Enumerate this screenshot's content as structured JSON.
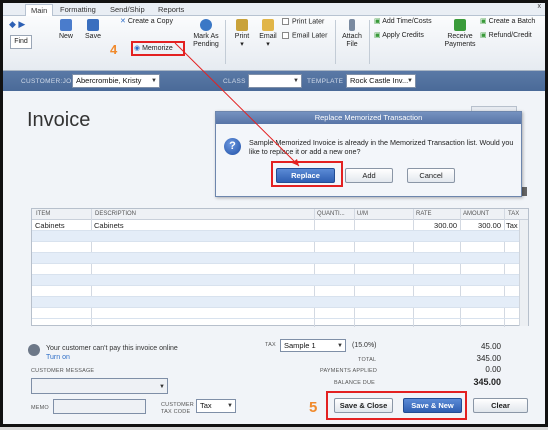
{
  "tabs": [
    "Main",
    "Formatting",
    "Send/Ship",
    "Reports"
  ],
  "ribbon": {
    "find": "Find",
    "new": "New",
    "save": "Save",
    "create_copy": "Create a Copy",
    "memorize": "Memorize",
    "mark_as_pending": [
      "Mark As",
      "Pending"
    ],
    "print": "Print",
    "email": "Email",
    "print_later": "Print Later",
    "email_later": "Email Later",
    "attach_file": [
      "Attach",
      "File"
    ],
    "add_time_costs": "Add Time/Costs",
    "apply_credits": "Apply Credits",
    "receive_payments": [
      "Receive",
      "Payments"
    ],
    "create_batch": "Create a Batch",
    "refund_credit": "Refund/Credit",
    "step_badge": "4"
  },
  "header": {
    "customer_job_label": "CUSTOMER:JOB",
    "customer_job_value": "Abercrombie, Kristy",
    "class_label": "CLASS",
    "class_value": "",
    "template_label": "TEMPLATE",
    "template_value": "Rock Castle Inv..."
  },
  "invoice_title": "Invoice",
  "dialog": {
    "title": "Replace Memorized Transaction",
    "message": "Sample Memorized Invoice is already in the Memorized Transaction list.  Would you like to replace it or add a new one?",
    "replace": "Replace",
    "add": "Add",
    "cancel": "Cancel"
  },
  "table": {
    "columns": [
      "ITEM",
      "DESCRIPTION",
      "QUANTI...",
      "U/M",
      "RATE",
      "AMOUNT",
      "TAX"
    ],
    "rows": [
      {
        "item": "Cabinets",
        "description": "Cabinets",
        "quantity": "",
        "um": "",
        "rate": "300.00",
        "amount": "300.00",
        "tax": "Tax"
      }
    ]
  },
  "footer": {
    "notice": "Your customer can't pay this invoice online",
    "turn_on": "Turn on",
    "customer_message_label": "CUSTOMER MESSAGE",
    "memo_label": "MEMO",
    "customer_tax_code_label": [
      "CUSTOMER",
      "TAX CODE"
    ],
    "tax_code_value": "Tax",
    "tax_label": "TAX",
    "tax_item": "Sample 1",
    "tax_rate": "(15.0%)",
    "tax_amount": "45.00",
    "total_label": "TOTAL",
    "total_value": "345.00",
    "payments_applied_label": "PAYMENTS APPLIED",
    "payments_applied_value": "0.00",
    "balance_due_label": "BALANCE DUE",
    "balance_due_value": "345.00",
    "step_badge": "5",
    "save_close": "Save & Close",
    "save_new": "Save & New",
    "clear": "Clear"
  },
  "colors": {
    "highlight_red": "#e32121",
    "step_orange": "#f08a2c",
    "header_blue": "#4f6f9e"
  }
}
